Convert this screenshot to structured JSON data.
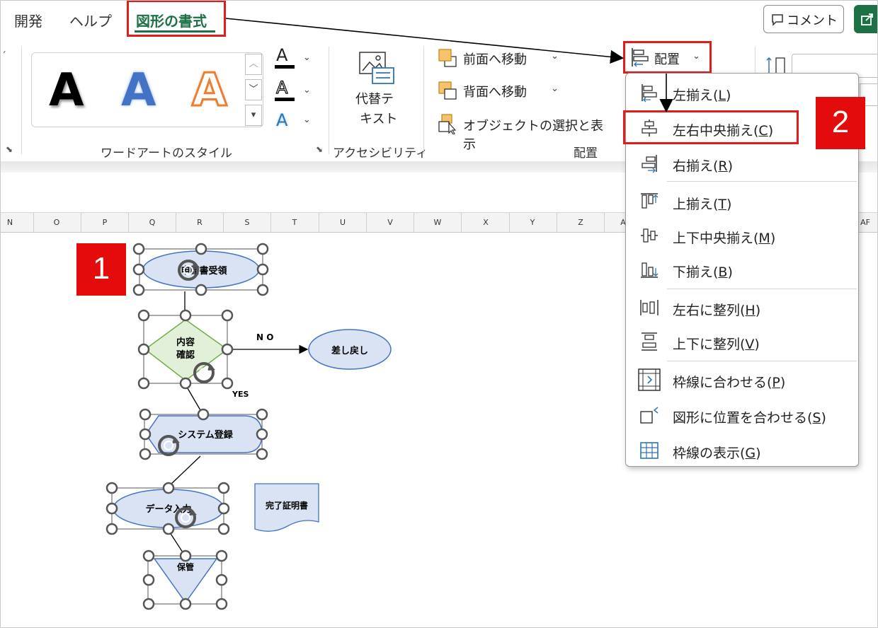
{
  "tabs": [
    {
      "label": "開発"
    },
    {
      "label": "ヘルプ"
    },
    {
      "label": "図形の書式",
      "active": true
    }
  ],
  "header": {
    "comment_label": "コメント"
  },
  "ribbon": {
    "wordart_group_label": "ワードアートのスタイル",
    "wordart_samples": [
      "A",
      "A",
      "A"
    ],
    "text_fill_glyph": "A",
    "alt_text_label": [
      "代替テ",
      "キスト"
    ],
    "accessibility_label": "アクセシビリティ",
    "arrange": {
      "bring_forward": "前面へ移動",
      "send_backward": "背面へ移動",
      "selection_pane": "オブジェクトの選択と表示",
      "group_label": "配置",
      "align_button": "配置"
    }
  },
  "align_menu": [
    {
      "label": "左揃え(",
      "key": "L",
      "end": ")",
      "icon": "align-left-icon"
    },
    {
      "label": "左右中央揃え(",
      "key": "C",
      "end": ")",
      "icon": "align-center-icon",
      "highlighted": true
    },
    {
      "label": "右揃え(",
      "key": "R",
      "end": ")",
      "icon": "align-right-icon"
    },
    {
      "label": "上揃え(",
      "key": "T",
      "end": ")",
      "icon": "align-top-icon"
    },
    {
      "label": "上下中央揃え(",
      "key": "M",
      "end": ")",
      "icon": "align-middle-icon"
    },
    {
      "label": "下揃え(",
      "key": "B",
      "end": ")",
      "icon": "align-bottom-icon"
    },
    {
      "label": "左右に整列(",
      "key": "H",
      "end": ")",
      "icon": "distribute-horizontal-icon"
    },
    {
      "label": "上下に整列(",
      "key": "V",
      "end": ")",
      "icon": "distribute-vertical-icon"
    },
    {
      "label": "枠線に合わせる(",
      "key": "P",
      "end": ")",
      "icon": "snap-to-grid-icon"
    },
    {
      "label": "図形に位置を合わせる(",
      "key": "S",
      "end": ")",
      "icon": "snap-to-shape-icon"
    },
    {
      "label": "枠線の表示(",
      "key": "G",
      "end": ")",
      "icon": "view-gridlines-icon"
    }
  ],
  "columns": [
    "N",
    "O",
    "P",
    "Q",
    "R",
    "S",
    "T",
    "U",
    "V",
    "W",
    "X",
    "Y",
    "Z",
    "A",
    "AF"
  ],
  "flowchart": {
    "start": "申請書受領",
    "decision_line1": "内容",
    "decision_line2": "確認",
    "no_label": "N O",
    "yes_label": "YES",
    "reject": "差し戻し",
    "register": "システム登録",
    "data": "データ入力",
    "certificate": "完了証明書",
    "store": "保管"
  },
  "badges": {
    "one": "1",
    "two": "2"
  },
  "colors": {
    "accent_green": "#1e7145",
    "highlight_red": "#e31b1b",
    "badge_red": "#e30b0b",
    "shape_fill": "#dae3f3",
    "shape_stroke": "#4472c4",
    "decision_fill": "#e2f0d9",
    "decision_stroke": "#70ad47"
  }
}
